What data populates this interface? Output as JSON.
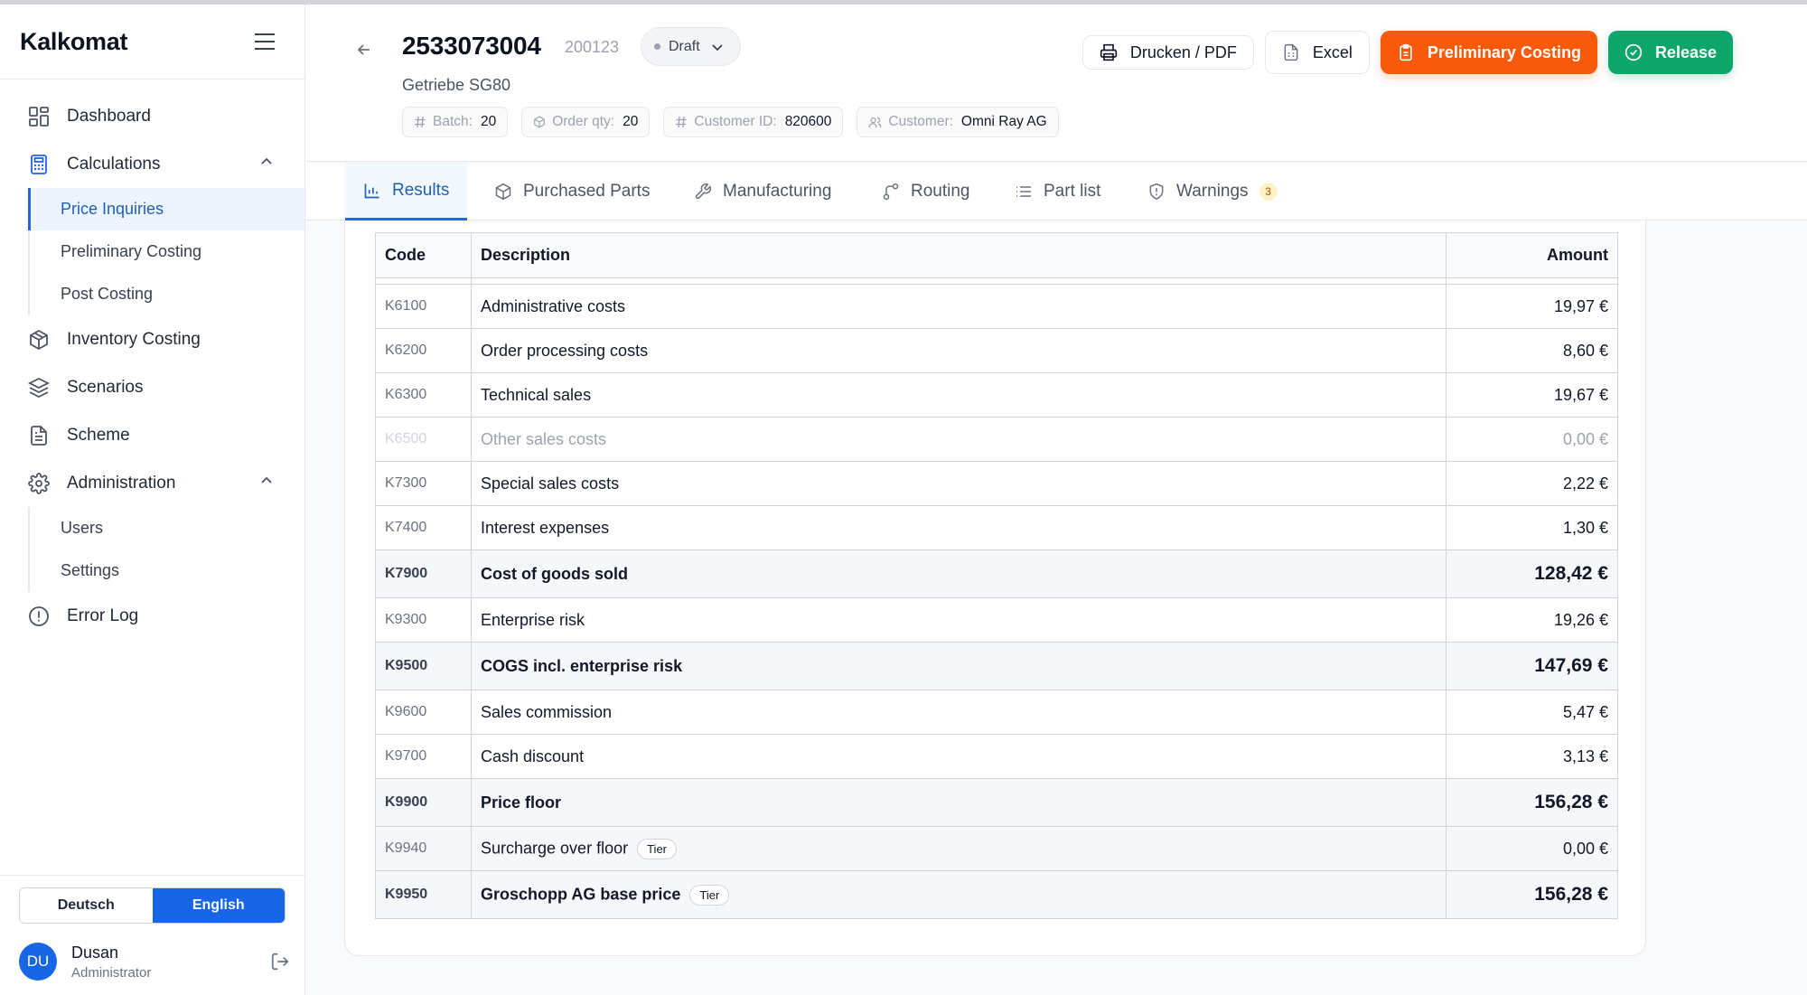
{
  "app": {
    "name": "Kalkomat"
  },
  "sidebar": {
    "items": [
      {
        "label": "Dashboard",
        "icon": "dashboard-icon"
      },
      {
        "label": "Calculations",
        "icon": "calculator-icon",
        "expanded": true,
        "children": [
          {
            "label": "Price Inquiries",
            "active": true
          },
          {
            "label": "Preliminary Costing"
          },
          {
            "label": "Post Costing"
          }
        ]
      },
      {
        "label": "Inventory Costing",
        "icon": "box-icon"
      },
      {
        "label": "Scenarios",
        "icon": "layers-icon"
      },
      {
        "label": "Scheme",
        "icon": "document-icon"
      },
      {
        "label": "Administration",
        "icon": "gear-icon",
        "expanded": true,
        "children": [
          {
            "label": "Users"
          },
          {
            "label": "Settings"
          }
        ]
      },
      {
        "label": "Error Log",
        "icon": "alert-circle-icon"
      }
    ],
    "language": {
      "options": [
        "Deutsch",
        "English"
      ],
      "selected": "English"
    },
    "user": {
      "initials": "DU",
      "name": "Dusan",
      "role": "Administrator"
    }
  },
  "header": {
    "title": "2533073004",
    "title_secondary": "200123",
    "status": "Draft",
    "subtitle": "Getriebe SG80",
    "chips": [
      {
        "key": "Batch:",
        "value": "20",
        "icon": "hash-icon"
      },
      {
        "key": "Order qty:",
        "value": "20",
        "icon": "package-icon"
      },
      {
        "key": "Customer ID:",
        "value": "820600",
        "icon": "hash-icon"
      },
      {
        "key": "Customer:",
        "value": "Omni Ray AG",
        "icon": "users-icon"
      }
    ],
    "actions": {
      "print": "Drucken / PDF",
      "excel": "Excel",
      "preliminary": "Preliminary Costing",
      "release": "Release"
    },
    "colors": {
      "orange": "#f75a0a",
      "green": "#0ea56a",
      "accent": "#2563eb"
    }
  },
  "tabs": [
    {
      "label": "Results",
      "icon": "bar-chart-icon",
      "active": true
    },
    {
      "label": "Purchased Parts",
      "icon": "package-icon"
    },
    {
      "label": "Manufacturing",
      "icon": "wrench-icon"
    },
    {
      "label": "Routing",
      "icon": "route-icon"
    },
    {
      "label": "Part list",
      "icon": "list-icon"
    },
    {
      "label": "Warnings",
      "icon": "shield-icon",
      "badge": "3"
    }
  ],
  "table": {
    "headers": {
      "code": "Code",
      "description": "Description",
      "amount": "Amount"
    },
    "rows": [
      {
        "code": "K6100",
        "description": "Administrative costs",
        "amount": "19,97 €"
      },
      {
        "code": "K6200",
        "description": "Order processing costs",
        "amount": "8,60 €"
      },
      {
        "code": "K6300",
        "description": "Technical sales",
        "amount": "19,67 €"
      },
      {
        "code": "K6500",
        "description": "Other sales costs",
        "amount": "0,00 €",
        "muted": true
      },
      {
        "code": "K7300",
        "description": "Special sales costs",
        "amount": "2,22 €"
      },
      {
        "code": "K7400",
        "description": "Interest expenses",
        "amount": "1,30 €"
      },
      {
        "code": "K7900",
        "description": "Cost of goods sold",
        "amount": "128,42 €",
        "bold": true
      },
      {
        "code": "K9300",
        "description": "Enterprise risk",
        "amount": "19,26 €"
      },
      {
        "code": "K9500",
        "description": "COGS incl. enterprise risk",
        "amount": "147,69 €",
        "bold": true
      },
      {
        "code": "K9600",
        "description": "Sales commission",
        "amount": "5,47 €"
      },
      {
        "code": "K9700",
        "description": "Cash discount",
        "amount": "3,13 €"
      },
      {
        "code": "K9900",
        "description": "Price floor",
        "amount": "156,28 €",
        "bold": true
      },
      {
        "code": "K9940",
        "description": "Surcharge over floor",
        "amount": "0,00 €",
        "tier": "Tier",
        "alt": true
      },
      {
        "code": "K9950",
        "description": "Groschopp AG base price",
        "amount": "156,28 €",
        "tier": "Tier",
        "bold": true
      }
    ]
  }
}
